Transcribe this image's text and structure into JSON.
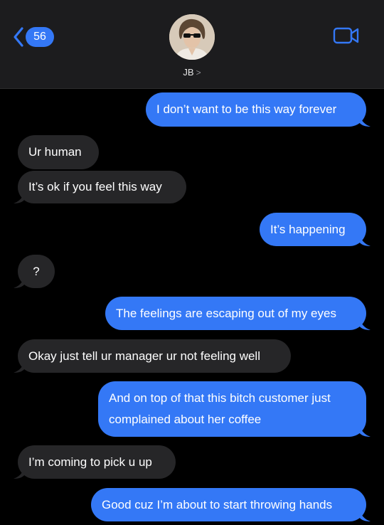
{
  "header": {
    "back_count": "56",
    "contact_name": "JB",
    "chevron": ">"
  },
  "messages": [
    {
      "dir": "out",
      "text": "I don’t want to be this way forever"
    },
    {
      "dir": "in",
      "text": "Ur human"
    },
    {
      "dir": "in",
      "text": "It’s ok if you feel this way"
    },
    {
      "dir": "out",
      "text": "It’s happening"
    },
    {
      "dir": "in",
      "text": "?"
    },
    {
      "dir": "out",
      "text": "The feelings are escaping out of my eyes"
    },
    {
      "dir": "in",
      "text": "Okay just tell ur manager ur not feeling well"
    },
    {
      "dir": "out",
      "text": "And on top of that this bitch customer just complained about her coffee"
    },
    {
      "dir": "in",
      "text": "I’m coming to pick u up"
    },
    {
      "dir": "out",
      "text": "Good cuz I’m about to start throwing hands"
    }
  ],
  "colors": {
    "outgoing": "#3478f6",
    "incoming": "#262628",
    "header": "#1c1c1e",
    "background": "#000000"
  }
}
